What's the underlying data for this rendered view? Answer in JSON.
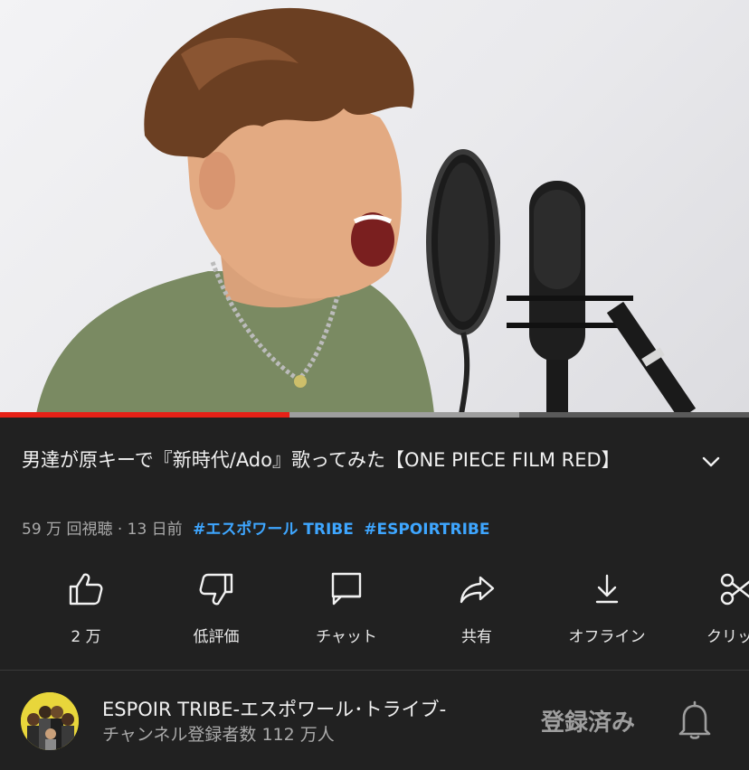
{
  "video": {
    "progress_played_fraction": 0.386,
    "progress_buffered_fraction": 0.693,
    "colors": {
      "played": "#e62117",
      "buffered": "#9e9e9e",
      "track": "#5a5a5a"
    }
  },
  "title": "男達が原キーで『新時代/Ado』歌ってみた【ONE PIECE FILM RED】",
  "meta": {
    "views_and_age": "59 万 回視聴 · 13 日前",
    "hashtags": [
      "#エスポワール TRIBE",
      "#ESPOIRTRIBE"
    ],
    "hashtag_color": "#3ea6ff"
  },
  "actions": [
    {
      "icon": "thumbs-up-icon",
      "label": "2 万"
    },
    {
      "icon": "thumbs-down-icon",
      "label": "低評価"
    },
    {
      "icon": "chat-icon",
      "label": "チャット"
    },
    {
      "icon": "share-icon",
      "label": "共有"
    },
    {
      "icon": "download-icon",
      "label": "オフライン"
    },
    {
      "icon": "scissors-icon",
      "label": "クリップ"
    }
  ],
  "channel": {
    "name": "ESPOIR TRIBE-エスポワール･トライブ-",
    "subscribers": "チャンネル登録者数 112 万人",
    "subscribe_label": "登録済み",
    "avatar_bg": "#e8d63b"
  }
}
